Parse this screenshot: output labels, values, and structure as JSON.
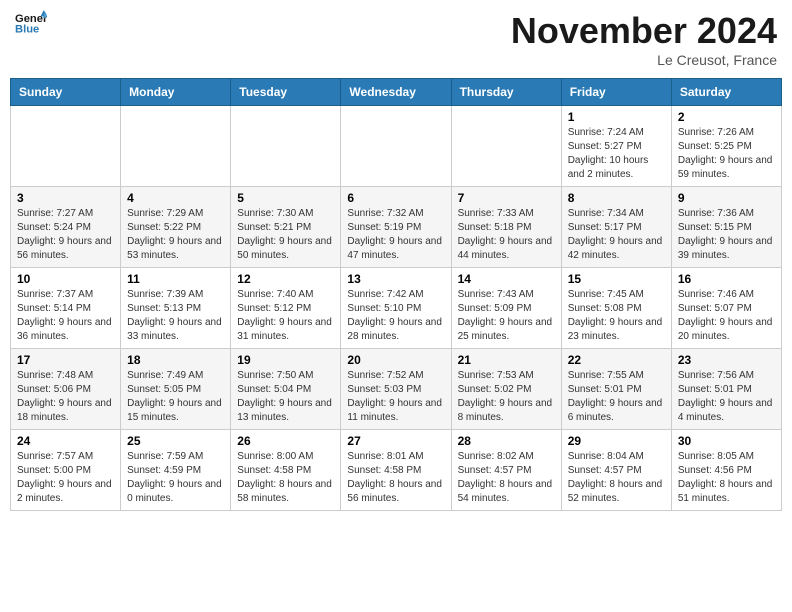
{
  "header": {
    "logo_line1": "General",
    "logo_line2": "Blue",
    "month": "November 2024",
    "location": "Le Creusot, France"
  },
  "weekdays": [
    "Sunday",
    "Monday",
    "Tuesday",
    "Wednesday",
    "Thursday",
    "Friday",
    "Saturday"
  ],
  "weeks": [
    [
      {
        "day": "",
        "info": ""
      },
      {
        "day": "",
        "info": ""
      },
      {
        "day": "",
        "info": ""
      },
      {
        "day": "",
        "info": ""
      },
      {
        "day": "",
        "info": ""
      },
      {
        "day": "1",
        "info": "Sunrise: 7:24 AM\nSunset: 5:27 PM\nDaylight: 10 hours and 2 minutes."
      },
      {
        "day": "2",
        "info": "Sunrise: 7:26 AM\nSunset: 5:25 PM\nDaylight: 9 hours and 59 minutes."
      }
    ],
    [
      {
        "day": "3",
        "info": "Sunrise: 7:27 AM\nSunset: 5:24 PM\nDaylight: 9 hours and 56 minutes."
      },
      {
        "day": "4",
        "info": "Sunrise: 7:29 AM\nSunset: 5:22 PM\nDaylight: 9 hours and 53 minutes."
      },
      {
        "day": "5",
        "info": "Sunrise: 7:30 AM\nSunset: 5:21 PM\nDaylight: 9 hours and 50 minutes."
      },
      {
        "day": "6",
        "info": "Sunrise: 7:32 AM\nSunset: 5:19 PM\nDaylight: 9 hours and 47 minutes."
      },
      {
        "day": "7",
        "info": "Sunrise: 7:33 AM\nSunset: 5:18 PM\nDaylight: 9 hours and 44 minutes."
      },
      {
        "day": "8",
        "info": "Sunrise: 7:34 AM\nSunset: 5:17 PM\nDaylight: 9 hours and 42 minutes."
      },
      {
        "day": "9",
        "info": "Sunrise: 7:36 AM\nSunset: 5:15 PM\nDaylight: 9 hours and 39 minutes."
      }
    ],
    [
      {
        "day": "10",
        "info": "Sunrise: 7:37 AM\nSunset: 5:14 PM\nDaylight: 9 hours and 36 minutes."
      },
      {
        "day": "11",
        "info": "Sunrise: 7:39 AM\nSunset: 5:13 PM\nDaylight: 9 hours and 33 minutes."
      },
      {
        "day": "12",
        "info": "Sunrise: 7:40 AM\nSunset: 5:12 PM\nDaylight: 9 hours and 31 minutes."
      },
      {
        "day": "13",
        "info": "Sunrise: 7:42 AM\nSunset: 5:10 PM\nDaylight: 9 hours and 28 minutes."
      },
      {
        "day": "14",
        "info": "Sunrise: 7:43 AM\nSunset: 5:09 PM\nDaylight: 9 hours and 25 minutes."
      },
      {
        "day": "15",
        "info": "Sunrise: 7:45 AM\nSunset: 5:08 PM\nDaylight: 9 hours and 23 minutes."
      },
      {
        "day": "16",
        "info": "Sunrise: 7:46 AM\nSunset: 5:07 PM\nDaylight: 9 hours and 20 minutes."
      }
    ],
    [
      {
        "day": "17",
        "info": "Sunrise: 7:48 AM\nSunset: 5:06 PM\nDaylight: 9 hours and 18 minutes."
      },
      {
        "day": "18",
        "info": "Sunrise: 7:49 AM\nSunset: 5:05 PM\nDaylight: 9 hours and 15 minutes."
      },
      {
        "day": "19",
        "info": "Sunrise: 7:50 AM\nSunset: 5:04 PM\nDaylight: 9 hours and 13 minutes."
      },
      {
        "day": "20",
        "info": "Sunrise: 7:52 AM\nSunset: 5:03 PM\nDaylight: 9 hours and 11 minutes."
      },
      {
        "day": "21",
        "info": "Sunrise: 7:53 AM\nSunset: 5:02 PM\nDaylight: 9 hours and 8 minutes."
      },
      {
        "day": "22",
        "info": "Sunrise: 7:55 AM\nSunset: 5:01 PM\nDaylight: 9 hours and 6 minutes."
      },
      {
        "day": "23",
        "info": "Sunrise: 7:56 AM\nSunset: 5:01 PM\nDaylight: 9 hours and 4 minutes."
      }
    ],
    [
      {
        "day": "24",
        "info": "Sunrise: 7:57 AM\nSunset: 5:00 PM\nDaylight: 9 hours and 2 minutes."
      },
      {
        "day": "25",
        "info": "Sunrise: 7:59 AM\nSunset: 4:59 PM\nDaylight: 9 hours and 0 minutes."
      },
      {
        "day": "26",
        "info": "Sunrise: 8:00 AM\nSunset: 4:58 PM\nDaylight: 8 hours and 58 minutes."
      },
      {
        "day": "27",
        "info": "Sunrise: 8:01 AM\nSunset: 4:58 PM\nDaylight: 8 hours and 56 minutes."
      },
      {
        "day": "28",
        "info": "Sunrise: 8:02 AM\nSunset: 4:57 PM\nDaylight: 8 hours and 54 minutes."
      },
      {
        "day": "29",
        "info": "Sunrise: 8:04 AM\nSunset: 4:57 PM\nDaylight: 8 hours and 52 minutes."
      },
      {
        "day": "30",
        "info": "Sunrise: 8:05 AM\nSunset: 4:56 PM\nDaylight: 8 hours and 51 minutes."
      }
    ]
  ]
}
